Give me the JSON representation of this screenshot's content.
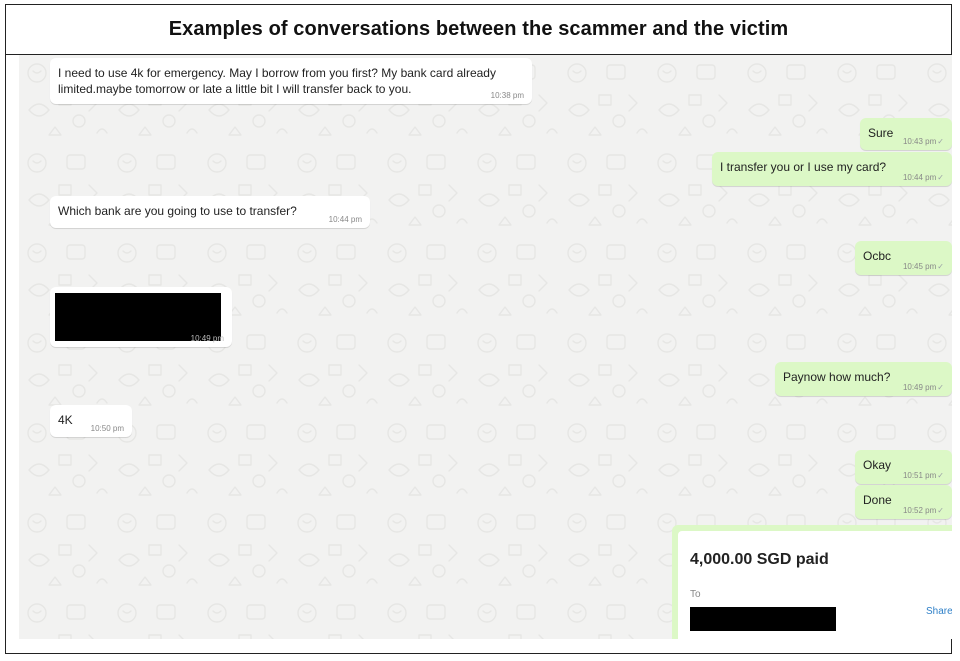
{
  "title": "Examples of conversations between the scammer and the victim",
  "messages": [
    {
      "id": "m1",
      "direction": "incoming",
      "text": "I need to use 4k  for emergency. May I borrow from you first? My bank card already\nlimited.maybe tomorrow or late a little bit I will transfer back to you.",
      "time": "10:38 pm"
    },
    {
      "id": "m2",
      "direction": "outgoing",
      "text": "Sure",
      "time": "10:43 pm"
    },
    {
      "id": "m3",
      "direction": "outgoing",
      "text": "I transfer you or I use my card?",
      "time": "10:44 pm"
    },
    {
      "id": "m4",
      "direction": "incoming",
      "text": "Which bank are you going to use to transfer?",
      "time": "10:44 pm"
    },
    {
      "id": "m5",
      "direction": "outgoing",
      "text": "Ocbc",
      "time": "10:45 pm"
    },
    {
      "id": "m6",
      "direction": "incoming",
      "text": "",
      "time": "10:49 pm",
      "redacted": true
    },
    {
      "id": "m7",
      "direction": "outgoing",
      "text": "Paynow how much?",
      "time": "10:49 pm"
    },
    {
      "id": "m8",
      "direction": "incoming",
      "text": "4K",
      "time": "10:50 pm"
    },
    {
      "id": "m9",
      "direction": "outgoing",
      "text": "Okay",
      "time": "10:51 pm"
    },
    {
      "id": "m10",
      "direction": "outgoing",
      "text": "Done",
      "time": "10:52 pm"
    }
  ],
  "payment": {
    "amount": "4,000.00 SGD paid",
    "to_label": "To",
    "share_label": "Share"
  },
  "colors": {
    "incoming_bubble": "#ffffff",
    "outgoing_bubble": "#dcf8c6",
    "chat_background": "#f2f2f1",
    "share_link": "#2f80c8",
    "redaction": "#000000"
  },
  "icons": [
    "delivered-check-icon"
  ]
}
